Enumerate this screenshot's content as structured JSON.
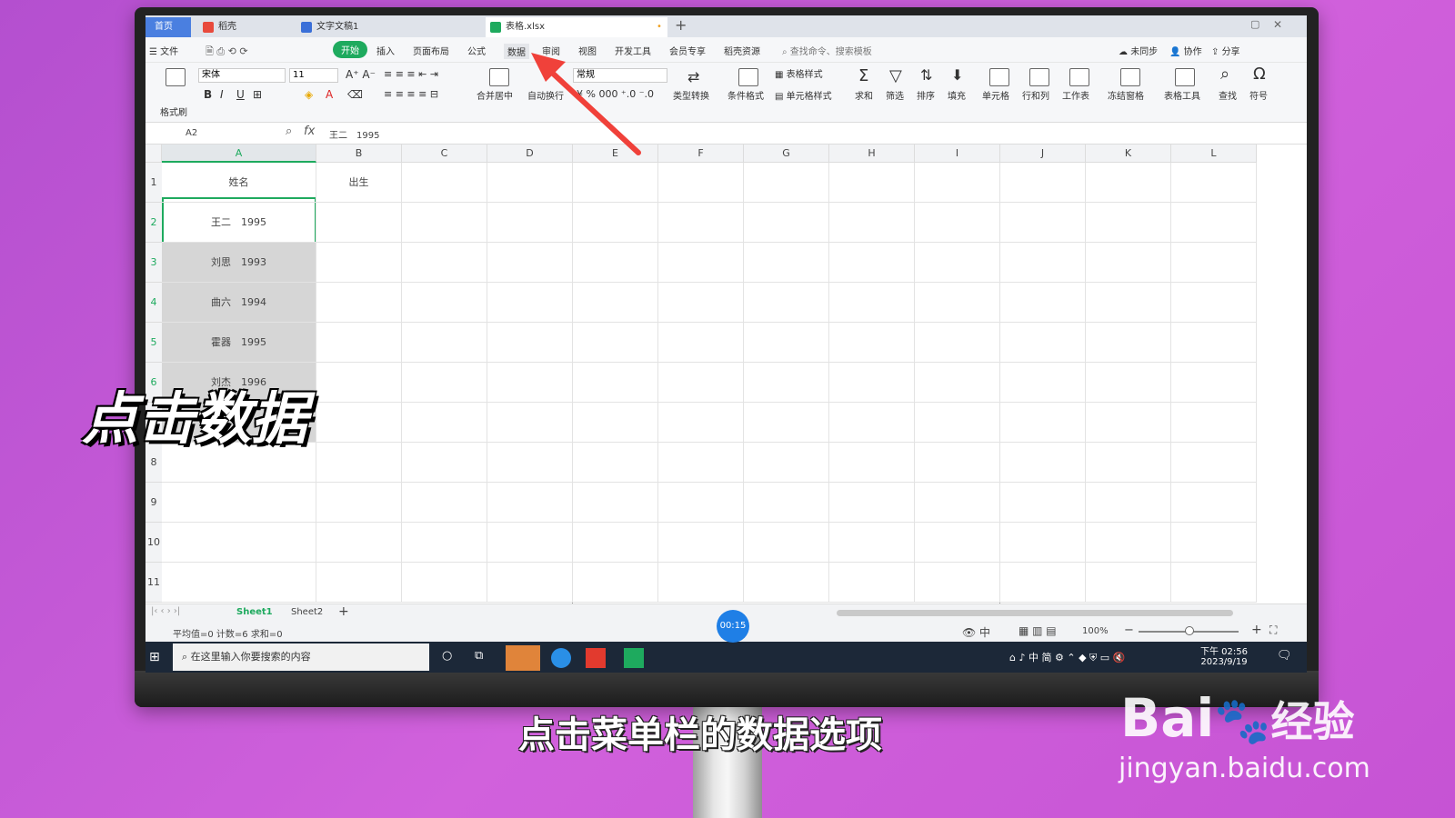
{
  "tabs": {
    "home": "首页",
    "docer": "稻壳",
    "word": "文字文稿1",
    "xlsx": "表格.xlsx"
  },
  "menubar": {
    "file": "文件",
    "start": "开始",
    "insert": "插入",
    "layout": "页面布局",
    "formula": "公式",
    "data": "数据",
    "review": "审阅",
    "view": "视图",
    "dev": "开发工具",
    "vip": "会员专享",
    "resources": "稻壳资源",
    "search": "查找命令、搜索模板",
    "unsynced": "未同步",
    "collab": "协作",
    "share": "分享"
  },
  "ribbon": {
    "format_painter": "格式刷",
    "font": "宋体",
    "size": "11",
    "merge": "合并居中",
    "wrap": "自动换行",
    "number_format": "常规",
    "convert": "类型转换",
    "cond_format": "条件格式",
    "table_style": "表格样式",
    "cell_style": "单元格样式",
    "sum": "求和",
    "filter": "筛选",
    "sort": "排序",
    "fill": "填充",
    "cell": "单元格",
    "rowcol": "行和列",
    "sheet": "工作表",
    "freeze": "冻结窗格",
    "tools": "表格工具",
    "find": "查找",
    "symbol": "符号"
  },
  "formula_bar": {
    "name_box": "A2",
    "content": "王二　1995"
  },
  "columns": [
    "A",
    "B",
    "C",
    "D",
    "E",
    "F",
    "G",
    "H",
    "I",
    "J",
    "K",
    "L"
  ],
  "rows": [
    "1",
    "2",
    "3",
    "4",
    "5",
    "6",
    "7",
    "8",
    "9",
    "10",
    "11"
  ],
  "cells": {
    "a1": "姓名",
    "b1": "出生",
    "a2": "王二　1995",
    "a3": "刘思　1993",
    "a4": "曲六　1994",
    "a5": "霍器　1995",
    "a6": "刘杰　1996"
  },
  "sheets": [
    "Sheet1",
    "Sheet2"
  ],
  "status": {
    "summary": "平均值=0  计数=6  求和=0",
    "zoom": "100%"
  },
  "timer": "00:15",
  "taskbar": {
    "search": "在这里输入你要搜索的内容",
    "time": "下午 02:56",
    "date": "2023/9/19",
    "ime": "中",
    "mode": "简"
  },
  "overlay": {
    "big": "点击数据",
    "subtitle": "点击菜单栏的数据选项"
  },
  "watermark": {
    "brand": "Bai",
    "brand2": "经验",
    "url": "jingyan.baidu.com"
  },
  "colors": {
    "accent": "#1eaa5e",
    "arrow": "#f0413a",
    "background": "#c35ad6"
  }
}
